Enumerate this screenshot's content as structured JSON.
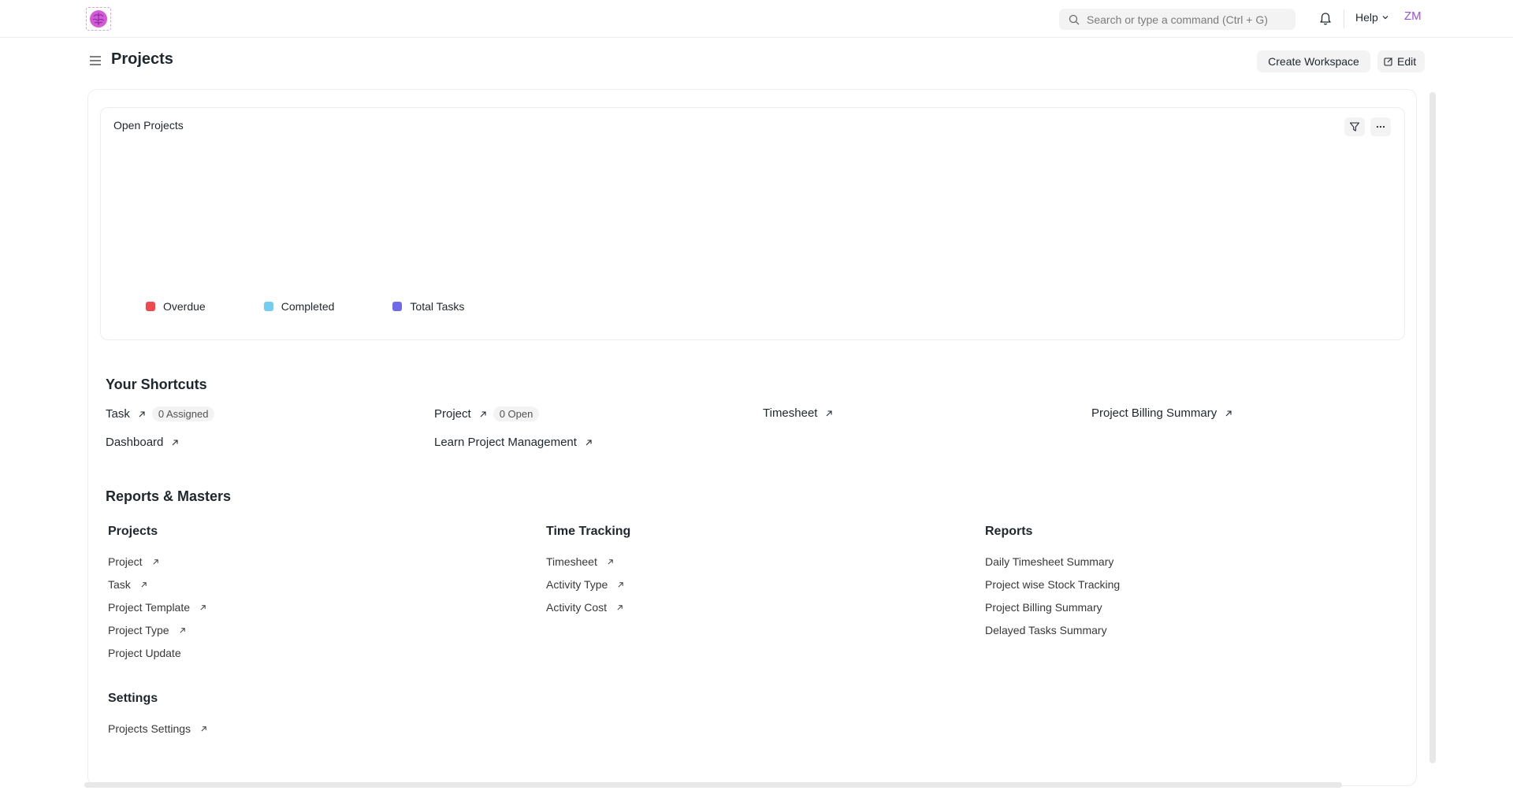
{
  "navbar": {
    "search_placeholder": "Search or type a command (Ctrl + G)",
    "help_label": "Help",
    "avatar_initials": "ZM"
  },
  "header": {
    "title": "Projects",
    "create_workspace_label": "Create Workspace",
    "edit_label": "Edit"
  },
  "chart": {
    "title": "Open Projects",
    "legend": [
      {
        "label": "Overdue",
        "color": "#f1484f"
      },
      {
        "label": "Completed",
        "color": "#72cdf0"
      },
      {
        "label": "Total Tasks",
        "color": "#6f6ae9"
      }
    ]
  },
  "chart_data": {
    "type": "bar",
    "title": "Open Projects",
    "categories": [],
    "series": [
      {
        "name": "Overdue",
        "values": []
      },
      {
        "name": "Completed",
        "values": []
      },
      {
        "name": "Total Tasks",
        "values": []
      }
    ],
    "legend_position": "bottom-left"
  },
  "shortcuts": {
    "title": "Your Shortcuts",
    "items": [
      {
        "label": "Task",
        "badge": "0 Assigned"
      },
      {
        "label": "Project",
        "badge": "0 Open"
      },
      {
        "label": "Timesheet"
      },
      {
        "label": "Project Billing Summary"
      },
      {
        "label": "Dashboard"
      },
      {
        "label": "Learn Project Management"
      }
    ]
  },
  "reports": {
    "title": "Reports & Masters",
    "cards": [
      {
        "title": "Projects",
        "links": [
          "Project",
          "Task",
          "Project Template",
          "Project Type",
          "Project Update"
        ]
      },
      {
        "title": "Time Tracking",
        "links": [
          "Timesheet",
          "Activity Type",
          "Activity Cost"
        ]
      },
      {
        "title": "Reports",
        "links": [
          "Daily Timesheet Summary",
          "Project wise Stock Tracking",
          "Project Billing Summary",
          "Delayed Tasks Summary"
        ]
      },
      {
        "title": "Settings",
        "links": [
          "Projects Settings"
        ]
      }
    ]
  },
  "colors": {
    "accent_avatar": "#9b4de0",
    "overdue": "#f1484f",
    "completed": "#72cdf0",
    "total_tasks": "#6f6ae9"
  }
}
